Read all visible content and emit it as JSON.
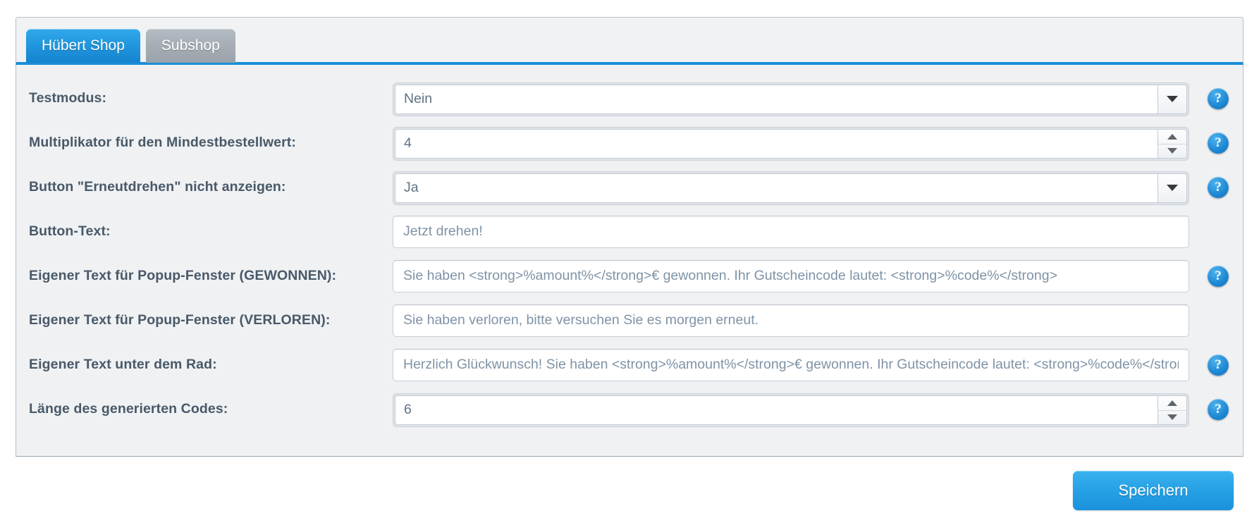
{
  "tabs": [
    {
      "label": "Hübert Shop",
      "active": true
    },
    {
      "label": "Subshop",
      "active": false
    }
  ],
  "form": {
    "rows": [
      {
        "label": "Testmodus:",
        "control": "select",
        "value": "Nein",
        "help": true,
        "help_icon": "question-mark-icon",
        "name": "testmodus"
      },
      {
        "label": "Multiplikator für den Mindestbestellwert:",
        "control": "spinner",
        "value": "4",
        "help": true,
        "help_icon": "question-mark-icon",
        "name": "multiplikator-mindestbestellwert"
      },
      {
        "label": "Button \"Erneutdrehen\" nicht anzeigen:",
        "control": "select",
        "value": "Ja",
        "help": true,
        "help_icon": "question-mark-icon",
        "name": "button-erneutdrehen-nicht-anzeigen"
      },
      {
        "label": "Button-Text:",
        "control": "text",
        "value": "Jetzt drehen!",
        "help": false,
        "name": "button-text"
      },
      {
        "label": "Eigener Text für Popup-Fenster (GEWONNEN):",
        "control": "text",
        "value": "Sie haben <strong>%amount%</strong>€ gewonnen. Ihr Gutscheincode lautet: <strong>%code%</strong>",
        "help": true,
        "help_icon": "question-mark-icon",
        "name": "popup-text-gewonnen"
      },
      {
        "label": "Eigener Text für Popup-Fenster (VERLOREN):",
        "control": "text",
        "value": "Sie haben verloren, bitte versuchen Sie es morgen erneut.",
        "help": false,
        "name": "popup-text-verloren"
      },
      {
        "label": "Eigener Text unter dem Rad:",
        "control": "text",
        "value": "Herzlich Glückwunsch! Sie haben <strong>%amount%</strong>€ gewonnen. Ihr Gutscheincode lautet: <strong>%code%</strong>",
        "help": true,
        "help_icon": "question-mark-icon",
        "name": "text-unter-dem-rad"
      },
      {
        "label": "Länge des generierten Codes:",
        "control": "spinner",
        "value": "6",
        "help": true,
        "help_icon": "question-mark-icon",
        "name": "laenge-generierter-code"
      }
    ]
  },
  "footer": {
    "save_label": "Speichern"
  },
  "colors": {
    "accent_blue": "#1b92dc",
    "tab_active_blue": "#2196dd",
    "tab_inactive_gray": "#a6adb5",
    "panel_bg": "#eff1f3",
    "label_text": "#495968",
    "field_text": "#7f93a6",
    "help_blue": "#1f8ad5"
  }
}
